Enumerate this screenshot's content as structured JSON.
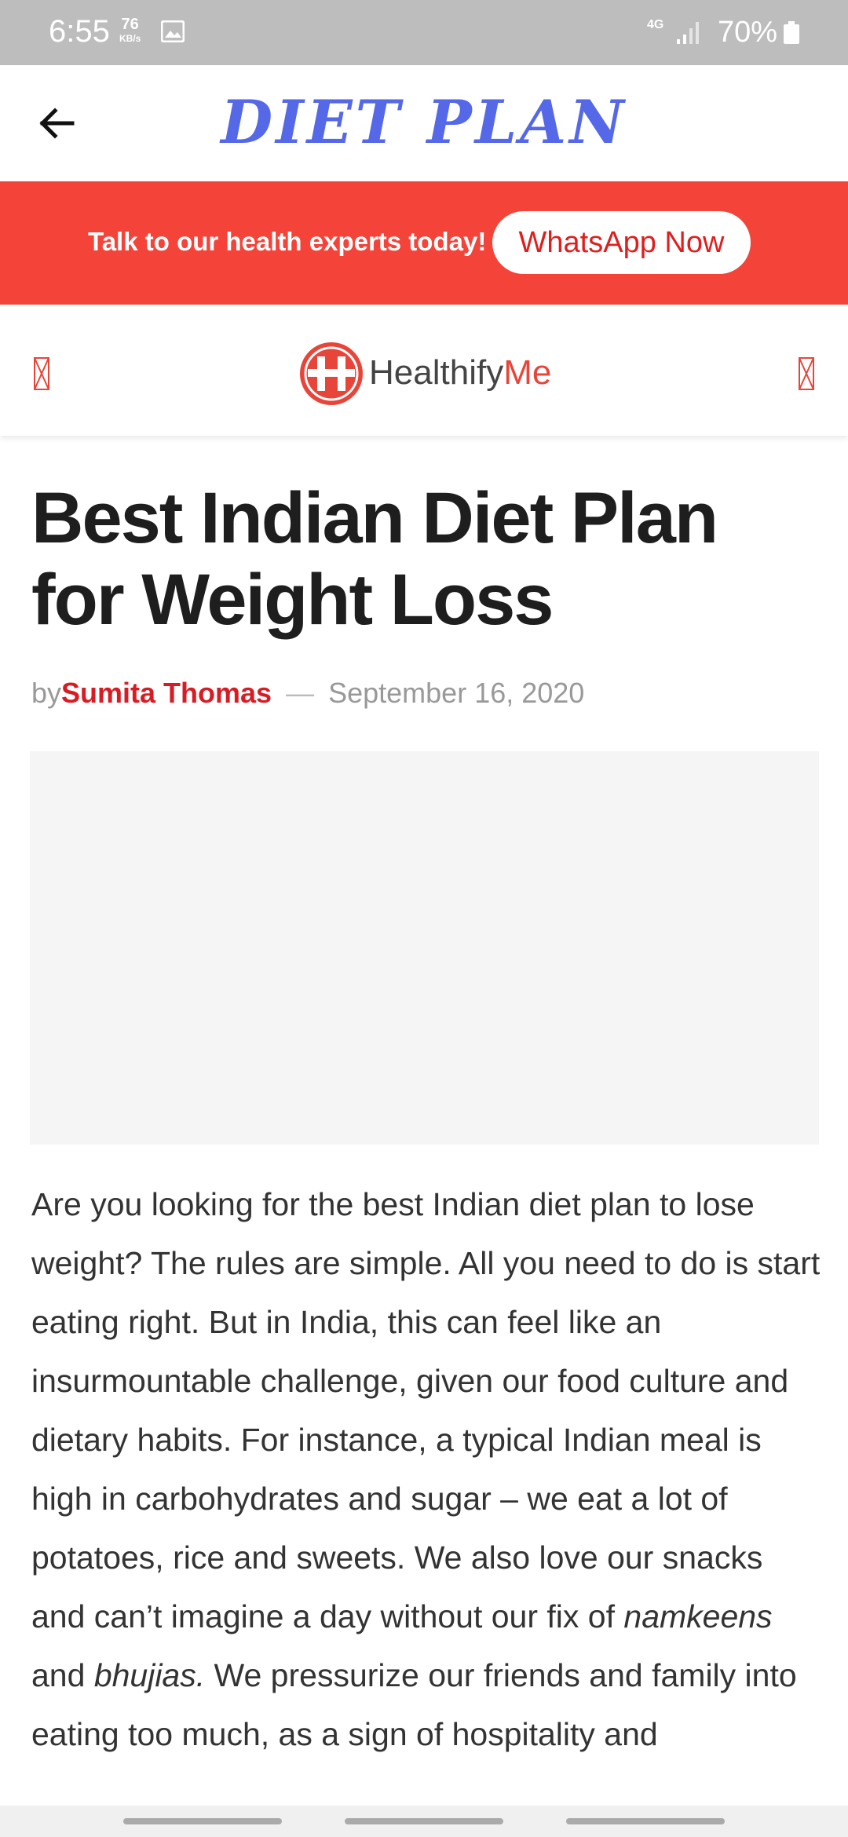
{
  "status_bar": {
    "time": "6:55",
    "speed_value": "76",
    "speed_unit": "KB/s",
    "network": "4G",
    "battery": "70%"
  },
  "app_bar": {
    "title": "DIET PLAN",
    "back_icon": "arrow-left-icon"
  },
  "promo": {
    "text": "Talk to our health experts today!",
    "button_label": "WhatsApp Now"
  },
  "site_header": {
    "logo_text_main": "Healthify",
    "logo_text_accent": "Me",
    "menu_icon": "menu-icon",
    "search_icon": "search-icon"
  },
  "article": {
    "title": "Best Indian Diet Plan for Weight Loss",
    "by_label": "by",
    "author": "Sumita Thomas",
    "separator": "—",
    "date": "September 16, 2020",
    "body_part1": "Are you looking for the best Indian diet plan to lose weight? The rules are simple. All you need to do is start eating right. But in India, this can feel like an insurmountable challenge, given our food culture and dietary habits. For instance, a typical Indian meal is high in carbohydrates and sugar – we eat a lot of potatoes, rice and sweets. We also love our snacks and can’t imagine a day without our fix of ",
    "body_em1": "namkeens",
    "body_part2": " and ",
    "body_em2": "bhujias.",
    "body_part3": " We pressurize our friends and family into eating too much, as a sign of hospitality and"
  },
  "colors": {
    "brand_blue": "#5468e8",
    "banner_red": "#f4443a",
    "author_red": "#d81c24"
  }
}
